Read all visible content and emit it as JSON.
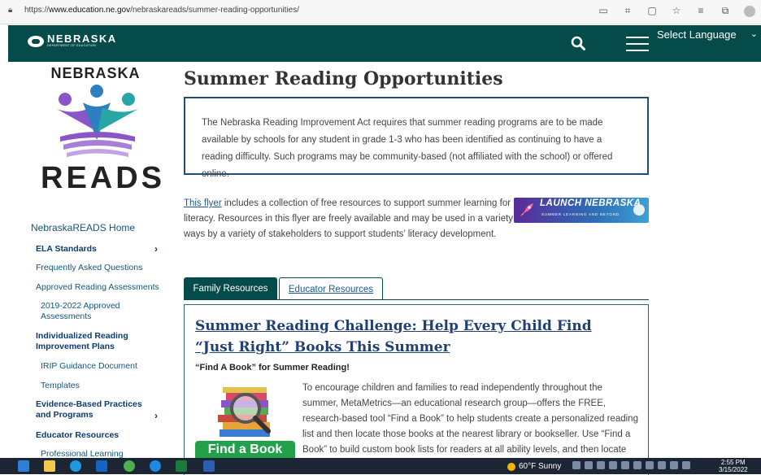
{
  "browser": {
    "url_prefix": "https://",
    "url_host": "www.education.ne.gov",
    "url_path": "/nebraskareads/summer-reading-opportunities/"
  },
  "header": {
    "logo_name": "NEBRASKA",
    "logo_sub": "DEPARTMENT OF EDUCATION",
    "language_label": "Select Language"
  },
  "sidebar": {
    "logo_top": "NEBRASKA",
    "logo_bottom": "READS",
    "home": "NebraskaREADS Home",
    "items": [
      {
        "label": "ELA Standards",
        "chevron": "›"
      },
      {
        "label": "Frequently Asked Questions"
      },
      {
        "label": "Approved Reading Assessments"
      },
      {
        "label": "2019-2022 Approved Assessments"
      },
      {
        "label": "Individualized Reading Improvement Plans"
      },
      {
        "label": "IRIP Guidance Document"
      },
      {
        "label": "Templates"
      },
      {
        "label": "Evidence-Based Practices and Programs",
        "chevron": "›"
      },
      {
        "label": "Educator Resources"
      },
      {
        "label": "Professional Learning"
      }
    ]
  },
  "main": {
    "title": "Summer Reading Opportunities",
    "intro": "The Nebraska Reading Improvement Act requires that summer reading programs are to be made available by schools for any student in grade 1-3 who has been identified as continuing to have a reading difficulty. Such programs may be community-based (not affiliated with the school) or offered online.",
    "flyer_link": "This flyer",
    "flyer_text": " includes a collection of free resources to support summer learning for literacy.  Resources in this flyer are freely available and may be used in a variety of ways by a variety of stakeholders to support students’ literacy development.",
    "banner_title": "LAUNCH NEBRASKA",
    "banner_sub": "SUMMER LEARNING AND BEYOND",
    "tabs": [
      {
        "label": "Family Resources"
      },
      {
        "label": "Educator Resources"
      }
    ],
    "challenge_title": "Summer Reading Challenge: Help Every Child Find “Just Right” Books This Summer",
    "challenge_sub": "“Find A Book” for Summer Reading!",
    "find_book_label": "Find a Book",
    "body": "To encourage children and families to read independently throughout the summer, MetaMetrics—an educational research group—offers the FREE, research-based tool “Find a Book” to help students create a personalized reading list and then locate those books at the nearest library or bookseller. Use “Find a Book” to build custom book lists for readers at all ability levels, and then locate"
  },
  "taskbar": {
    "weather": "60°F  Sunny",
    "time": "2:55 PM",
    "date": "3/15/2022"
  },
  "colors": {
    "header_bg": "#044b4a",
    "link": "#1a5a9c",
    "nav_bold": "#0b3c6e",
    "find_book_green": "#22a04a"
  }
}
